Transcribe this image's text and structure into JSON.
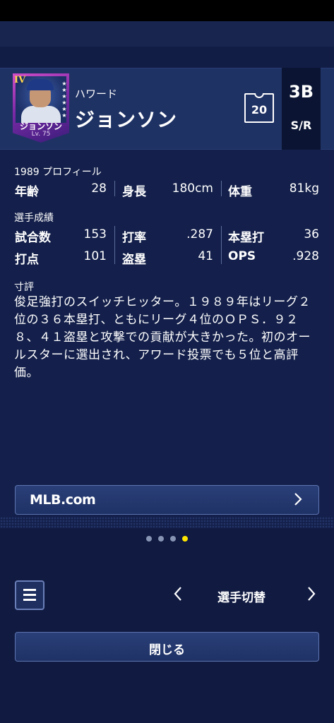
{
  "player": {
    "rank": "IV",
    "card_name": "ジョンソン",
    "card_level": "Lv. 75",
    "first_name": "ハワード",
    "last_name": "ジョンソン",
    "jersey_number": "20",
    "position": "3B",
    "bats_throws": "S/R"
  },
  "profile": {
    "label": "1989 プロフィール",
    "age_label": "年齢",
    "age": "28",
    "height_label": "身長",
    "height": "180cm",
    "weight_label": "体重",
    "weight": "81kg"
  },
  "stats": {
    "label": "選手成績",
    "games_label": "試合数",
    "games": "153",
    "avg_label": "打率",
    "avg": ".287",
    "hr_label": "本塁打",
    "hr": "36",
    "rbi_label": "打点",
    "rbi": "101",
    "sb_label": "盗塁",
    "sb": "41",
    "ops_label": "OPS",
    "ops": ".928"
  },
  "comment": {
    "label": "寸評",
    "text": "俊足強打のスイッチヒッター。１９８９年はリーグ２位の３６本塁打、ともにリーグ４位のＯＰＳ．９２８、４１盗塁と攻撃での貢献が大きかった。初のオールスターに選出され、アワード投票でも５位と高評価。"
  },
  "links": {
    "mlb_label": "MLB.com"
  },
  "pager": {
    "count": 4,
    "active_index": 3
  },
  "nav": {
    "switch_label": "選手切替",
    "prev_icon": "chevron-left-icon",
    "next_icon": "chevron-right-icon",
    "menu_icon": "menu-icon"
  },
  "footer": {
    "close_label": "閉じる"
  },
  "colors": {
    "background": "#14204b",
    "header": "#1f3264",
    "active_dot": "#ffe600",
    "card_accent": "#7a2aa6"
  }
}
